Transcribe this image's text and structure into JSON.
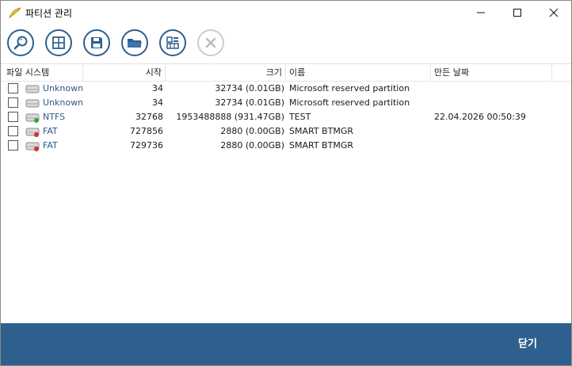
{
  "window": {
    "title": "파티션 관리"
  },
  "toolbar": {
    "buttons": [
      {
        "icon": "search-icon"
      },
      {
        "icon": "grid-icon"
      },
      {
        "icon": "save-icon"
      },
      {
        "icon": "folder-icon"
      },
      {
        "icon": "partition-map-icon"
      },
      {
        "icon": "delete-icon",
        "disabled": true
      }
    ]
  },
  "table": {
    "columns": [
      "파일 시스템",
      "시작",
      "크기",
      "이름",
      "만든 날짜"
    ],
    "rows": [
      {
        "fs": "Unknown",
        "start": "34",
        "size": "32734 (0.01GB)",
        "name": "Microsoft reserved partition",
        "date": "",
        "drive": "plain"
      },
      {
        "fs": "Unknown",
        "start": "34",
        "size": "32734 (0.01GB)",
        "name": "Microsoft reserved partition",
        "date": "",
        "drive": "plain"
      },
      {
        "fs": "NTFS",
        "start": "32768",
        "size": "1953488888 (931.47GB)",
        "name": "TEST",
        "date": "22.04.2026 00:50:39",
        "drive": "green"
      },
      {
        "fs": "FAT",
        "start": "727856",
        "size": "2880 (0.00GB)",
        "name": "SMART BTMGR",
        "date": "",
        "drive": "red"
      },
      {
        "fs": "FAT",
        "start": "729736",
        "size": "2880 (0.00GB)",
        "name": "SMART BTMGR",
        "date": "",
        "drive": "red"
      }
    ]
  },
  "footer": {
    "close_label": "닫기"
  },
  "colors": {
    "accent": "#2f5f8d",
    "fs_text": "#2c5a8c"
  }
}
